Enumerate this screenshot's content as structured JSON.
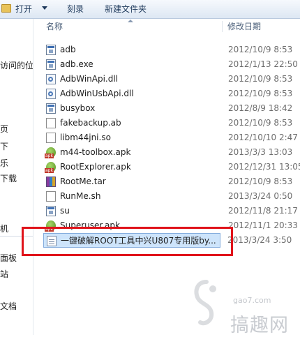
{
  "toolbar": {
    "open_label": "打开",
    "burn_label": "刻录",
    "new_folder_label": "新建文件夹"
  },
  "nav": {
    "items": [
      "访问的位置",
      "页",
      "下",
      "乐",
      "下载",
      "机",
      "面板",
      "站",
      "文档"
    ]
  },
  "columns": {
    "name": "名称",
    "modified": "修改日期"
  },
  "files": [
    {
      "name": "adb",
      "date": "2012/10/9 8:53",
      "icon": "windows-file-icon"
    },
    {
      "name": "adb.exe",
      "date": "2012/1/13 22:50",
      "icon": "exe-icon"
    },
    {
      "name": "AdbWinApi.dll",
      "date": "2012/10/9 8:53",
      "icon": "dll-icon"
    },
    {
      "name": "AdbWinUsbApi.dll",
      "date": "2012/10/9 8:53",
      "icon": "dll-icon"
    },
    {
      "name": "busybox",
      "date": "2012/8/9 18:42",
      "icon": "windows-file-icon"
    },
    {
      "name": "fakebackup.ab",
      "date": "2012/10/9 8:53",
      "icon": "blank-file-icon"
    },
    {
      "name": "libm44jni.so",
      "date": "2012/10/10 2:47",
      "icon": "blank-file-icon"
    },
    {
      "name": "m44-toolbox.apk",
      "date": "2013/3/3 13:03",
      "icon": "apk-icon"
    },
    {
      "name": "RootExplorer.apk",
      "date": "2012/12/31 13:05",
      "icon": "apk-icon"
    },
    {
      "name": "RootMe.tar",
      "date": "2012/10/9 8:53",
      "icon": "archive-icon"
    },
    {
      "name": "RunMe.sh",
      "date": "2013/3/24 0:50",
      "icon": "blank-file-icon"
    },
    {
      "name": "su",
      "date": "2012/11/8 21:17",
      "icon": "windows-file-icon"
    },
    {
      "name": "Superuser.apk",
      "date": "2012/11/1 20:33",
      "icon": "apk-icon"
    },
    {
      "name": "一键破解ROOT工具中兴U807专用版by...",
      "date": "2013/3/24 3:50",
      "icon": "script-icon"
    }
  ],
  "watermark": {
    "site": "gao7.com",
    "text": "搞趣网"
  },
  "colors": {
    "selection": "#cde4fb",
    "highlight_box": "#e0141b"
  }
}
